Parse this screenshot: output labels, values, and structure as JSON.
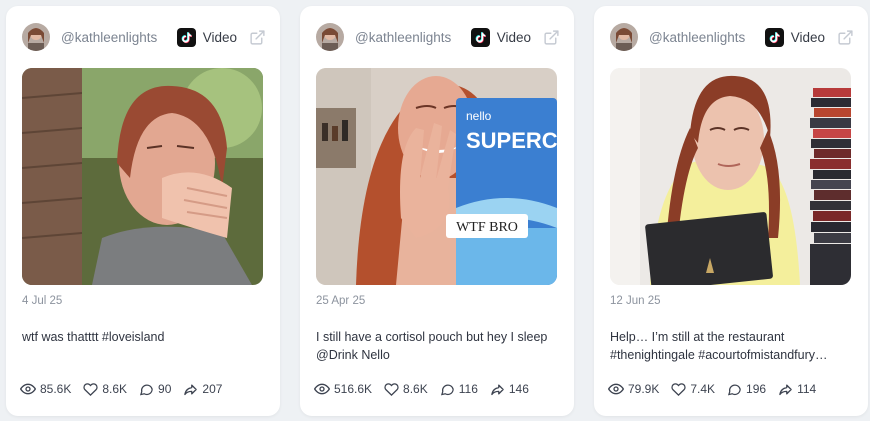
{
  "posts": [
    {
      "handle": "@kathleenlights",
      "type": "Video",
      "date": "4 Jul 25",
      "caption_lines": [
        "wtf was thatttt #loveisland",
        ""
      ],
      "views": "85.6K",
      "likes": "8.6K",
      "comments": "90",
      "shares": "207"
    },
    {
      "handle": "@kathleenlights",
      "type": "Video",
      "date": "25 Apr 25",
      "caption_lines": [
        "I still have a cortisol pouch but hey I sleep",
        "@Drink Nello"
      ],
      "overlay_text": "WTF BRO",
      "product_text": [
        "nello",
        "SUPERCA"
      ],
      "views": "516.6K",
      "likes": "8.6K",
      "comments": "116",
      "shares": "146"
    },
    {
      "handle": "@kathleenlights",
      "type": "Video",
      "date": "12 Jun 25",
      "caption_lines": [
        "Help… I’m still at the restaurant",
        "#thenightingale #acourtofmistandfury…"
      ],
      "views": "79.9K",
      "likes": "7.4K",
      "comments": "196",
      "shares": "114"
    }
  ],
  "icons": [
    "tiktok-icon",
    "external-link-icon",
    "eye-icon",
    "heart-icon",
    "comment-icon",
    "share-icon"
  ],
  "colors": {
    "background": "#eef1f4",
    "card": "#ffffff",
    "muted": "#7c8491"
  }
}
